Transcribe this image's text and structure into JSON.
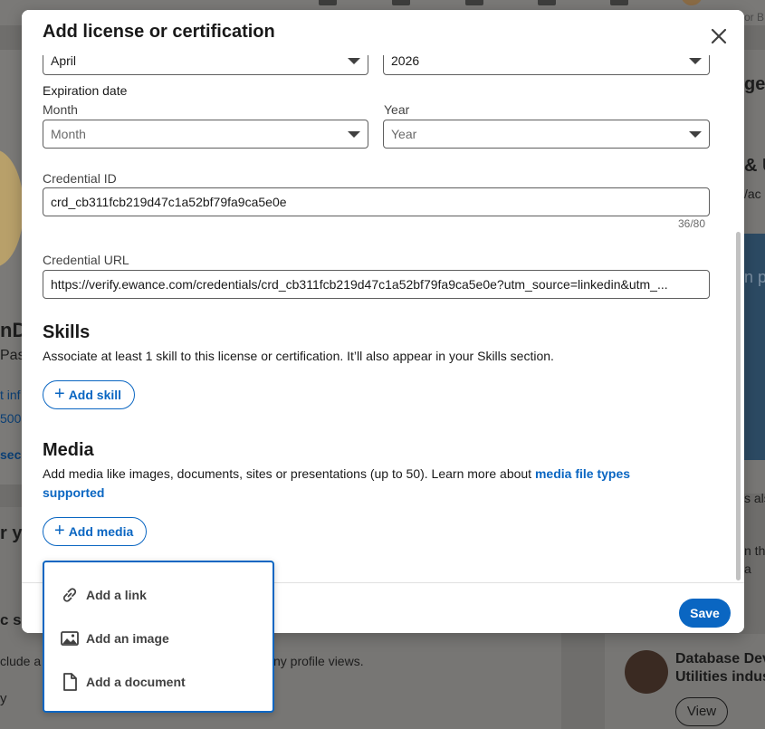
{
  "background": {
    "top_right_text": "or B",
    "left_texts": [
      "nD",
      "Pas",
      "t inf",
      "500",
      "sec",
      "r yo",
      "c su",
      "clude a",
      "y"
    ],
    "right_texts": [
      "ge",
      "& U",
      "/ac",
      "n p",
      "s als",
      "n th",
      "a"
    ],
    "profile_views_text": "ny profile views.",
    "suggestion": {
      "name_line1": "Database Dev",
      "name_line2": "Utilities indus",
      "view_label": "View"
    }
  },
  "modal": {
    "title": "Add license or certification",
    "close_icon": "close-icon",
    "issue_month_value": "April",
    "issue_year_value": "2026",
    "expiration": {
      "label": "Expiration date",
      "month_label": "Month",
      "month_placeholder": "Month",
      "year_label": "Year",
      "year_placeholder": "Year"
    },
    "credential_id": {
      "label": "Credential ID",
      "value": "crd_cb311fcb219d47c1a52bf79fa9ca5e0e",
      "counter": "36/80"
    },
    "credential_url": {
      "label": "Credential URL",
      "value": "https://verify.ewance.com/credentials/crd_cb311fcb219d47c1a52bf79fa9ca5e0e?utm_source=linkedin&utm_..."
    },
    "skills": {
      "heading": "Skills",
      "description": "Associate at least 1 skill to this license or certification. It’ll also appear in your Skills section.",
      "add_label": "Add skill"
    },
    "media": {
      "heading": "Media",
      "description": "Add media like images, documents, sites or presentations (up to 50). Learn more about ",
      "link_text": "media file types supported",
      "add_label": "Add media"
    },
    "save_label": "Save"
  },
  "media_menu": {
    "items": [
      {
        "label": "Add a link",
        "icon": "link-icon"
      },
      {
        "label": "Add an image",
        "icon": "image-icon"
      },
      {
        "label": "Add a document",
        "icon": "document-icon"
      }
    ]
  },
  "colors": {
    "accent": "#0a66c2",
    "overlay": "#6f6e6c"
  }
}
